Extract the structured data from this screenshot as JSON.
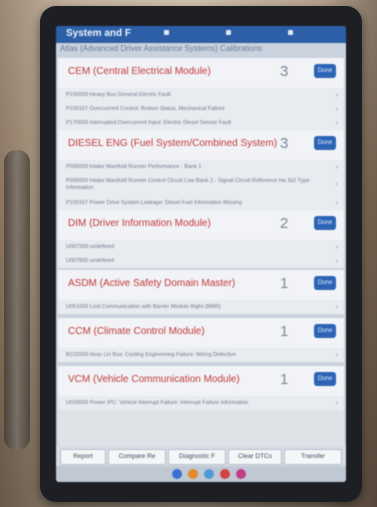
{
  "app": {
    "title": "System and F",
    "subtitle": "Atlas (Advanced Driver Assistance Systems) Calibrations"
  },
  "modules": [
    {
      "name": "CEM (Central Electrical Module)",
      "count": "3",
      "pill": "Done",
      "dtcs": [
        "P100000 Heavy Bus General Electric Fault",
        "P100167 Overcurrent Control: Broken Status, Mechanical Failure",
        "P170000 Interrupted Overcurrent Input: Electric Diesel Sensor Fault"
      ]
    },
    {
      "name": "DIESEL ENG (Fuel System/Combined System)",
      "count": "3",
      "pill": "Done",
      "dtcs": [
        "P006000 Intake Manifold Runner Performance - Bank 1",
        "P006600 Intake Manifold Runner Control Circuit Low Bank 2 - Signal Circuit Reference Ha 1k2 Type Information",
        "P100167 Power Drive System Leakage: Diesel Fuel Information Missing"
      ]
    },
    {
      "name": "DIM (Driver Information Module)",
      "count": "2",
      "pill": "Done",
      "dtcs": [
        "U007300 undefined",
        "U007800 undefined"
      ]
    },
    {
      "name": "ASDM (Active Safety Domain Master)",
      "count": "1",
      "pill": "Done",
      "label": "Done",
      "dtcs": [
        "U051000 Lost Communication with Barrier Module Right (BMR)"
      ]
    },
    {
      "name": "CCM (Climate Control Module)",
      "count": "1",
      "pill": "Done",
      "dtcs": [
        "B102000 Hvac Lin Bus: Cooling Engineering Failure: Wiring Defective"
      ]
    },
    {
      "name": "VCM (Vehicle Communication Module)",
      "count": "1",
      "pill": "Done",
      "dtcs": [
        "U030000 Power IPC: Vehicle Interrupt Failure: Interrupt Failure Information"
      ]
    }
  ],
  "buttons": [
    "Report",
    "Compare Re",
    "Diagnostic F",
    "Clear DTCs",
    "Transfer"
  ]
}
